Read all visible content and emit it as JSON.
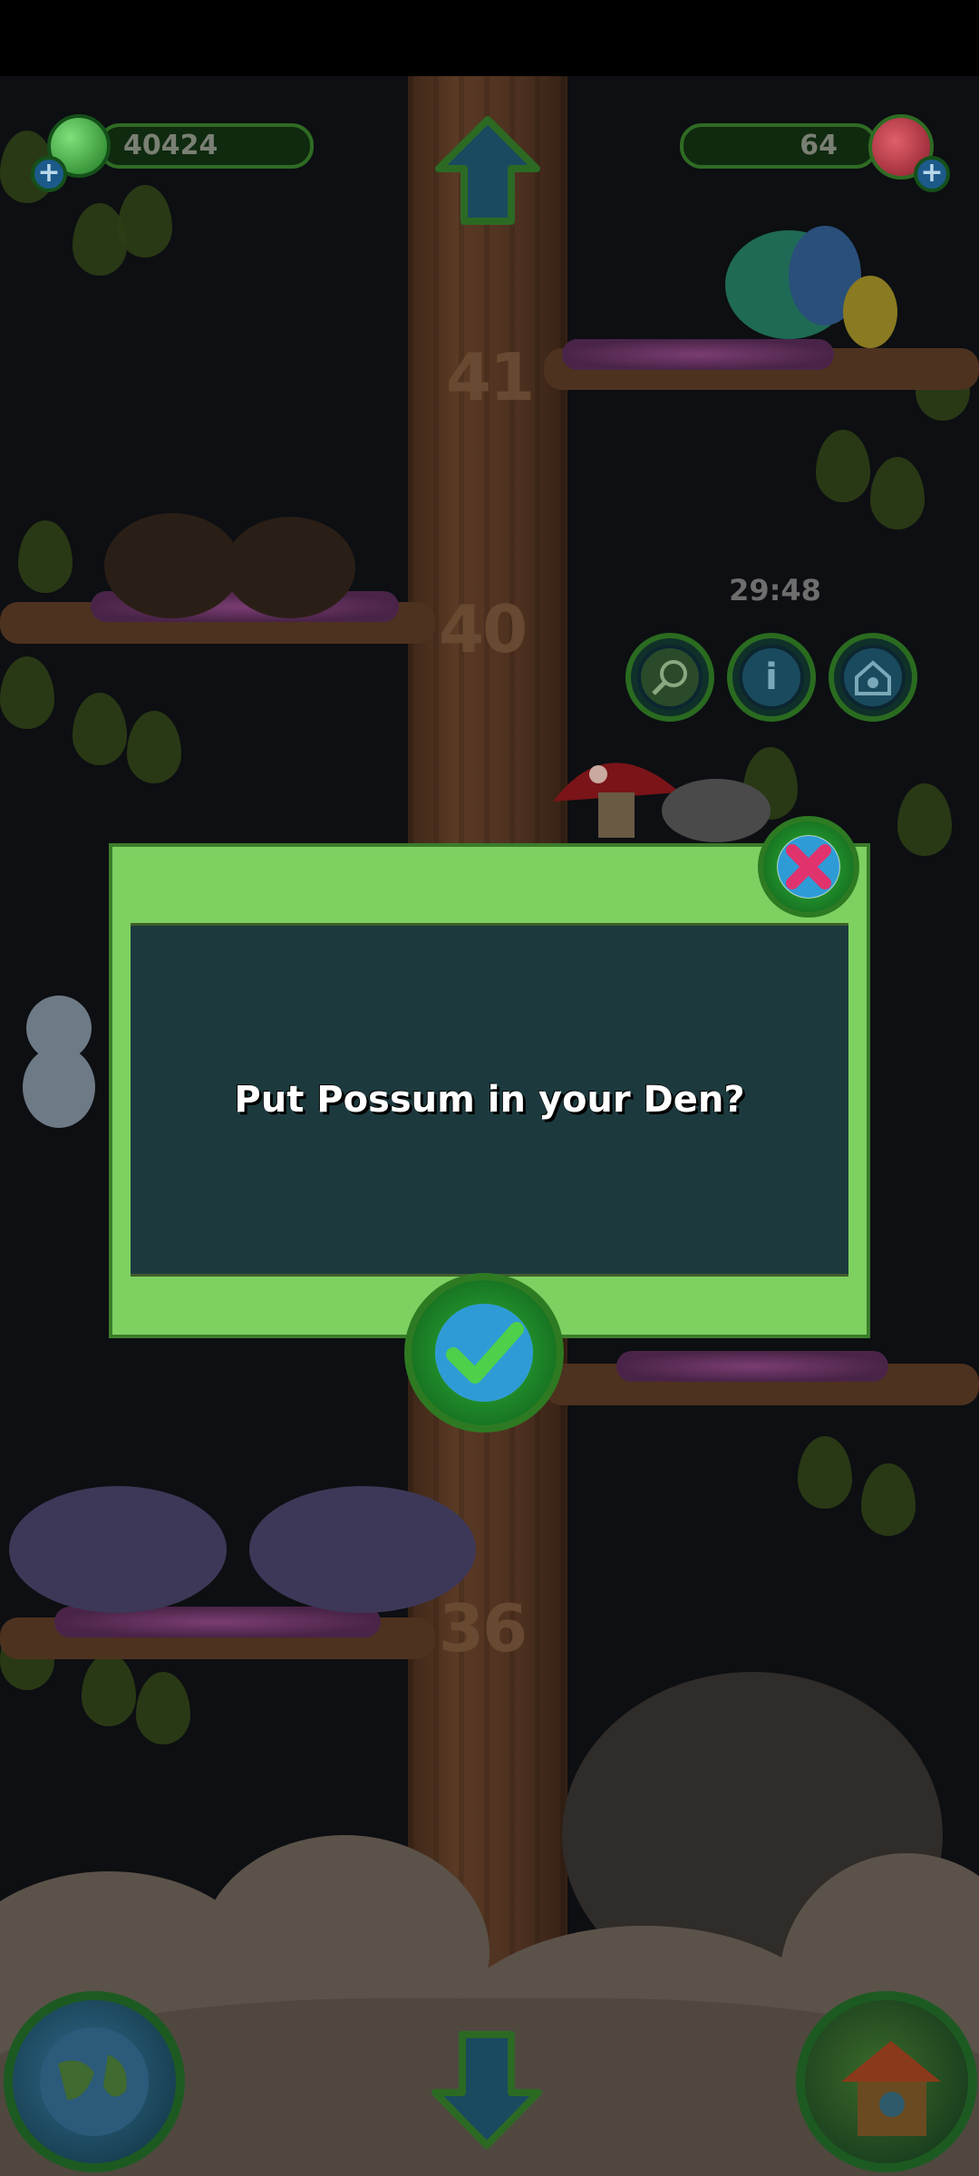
{
  "hud": {
    "coins_value": "40424",
    "gems_value": "64",
    "timer": "29:48"
  },
  "floors": {
    "f41": "41",
    "f40": "40",
    "f36": "36"
  },
  "dialog": {
    "message": "Put Possum in your Den?"
  },
  "icons": {
    "coins": "green-coin-icon",
    "gems": "red-gem-icon",
    "close": "close-x-icon",
    "confirm": "checkmark-icon",
    "net": "net-icon",
    "info": "info-icon",
    "den": "den-house-icon",
    "up": "up-arrow-icon",
    "down": "down-arrow-icon",
    "globe": "globe-icon",
    "home": "treehouse-icon"
  },
  "colors": {
    "dialog_frame": "#7ed061",
    "dialog_panel": "#1c3a3e",
    "close_accent": "#e0336e",
    "confirm_accent": "#2f9bd6"
  }
}
